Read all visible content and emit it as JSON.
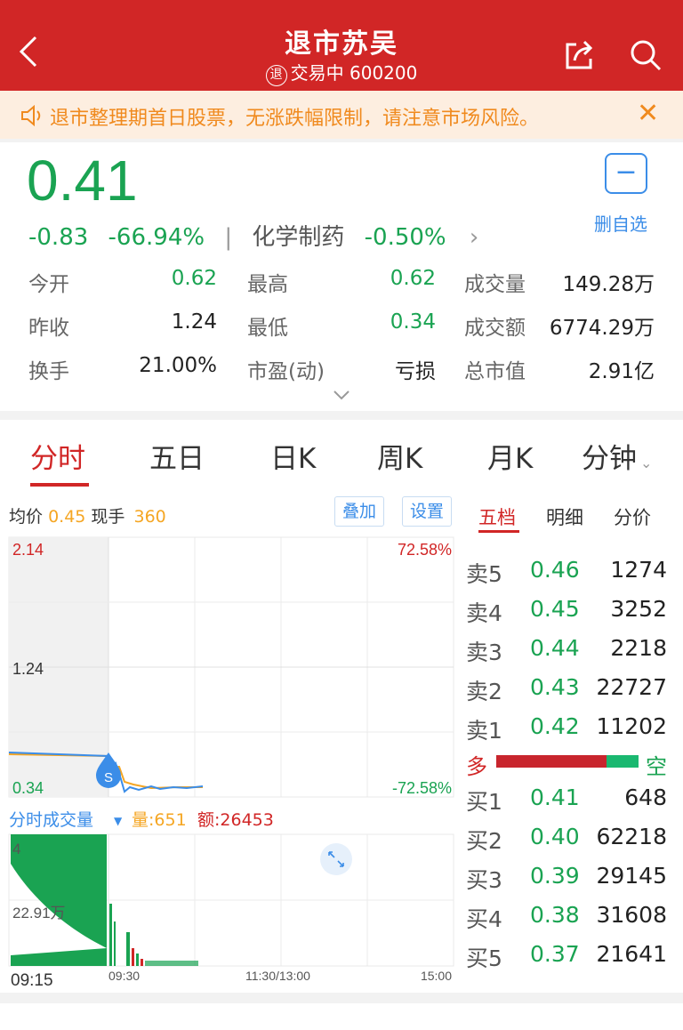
{
  "header": {
    "title": "退市苏吴",
    "badge": "退",
    "subtitle": "交易中 600200"
  },
  "notice": {
    "text": "退市整理期首日股票，无涨跌幅限制，请注意市场风险。",
    "close": "✕"
  },
  "quote": {
    "price": "0.41",
    "change": "-0.83",
    "change_pct": "-66.94%",
    "sector": "化学制药",
    "sector_pct": "-0.50%",
    "watchlist_label": "删自选",
    "stats": [
      {
        "label": "今开",
        "value": "0.62"
      },
      {
        "label": "最高",
        "value": "0.62"
      },
      {
        "label": "成交量",
        "value": "149.28万"
      },
      {
        "label": "昨收",
        "value": "1.24"
      },
      {
        "label": "最低",
        "value": "0.34"
      },
      {
        "label": "成交额",
        "value": "6774.29万"
      },
      {
        "label": "换手",
        "value": "21.00%"
      },
      {
        "label": "市盈(动)",
        "value": "亏损"
      },
      {
        "label": "总市值",
        "value": "2.91亿"
      }
    ]
  },
  "tabs": [
    "分时",
    "五日",
    "日K",
    "周K",
    "月K",
    "分钟"
  ],
  "chart": {
    "avg_label": "均价",
    "avg_value": "0.45",
    "cur_label": "现手",
    "cur_value": "360",
    "overlay_btn": "叠加",
    "settings_btn": "设置",
    "y_top": "2.14",
    "y_mid": "1.24",
    "y_bot": "0.34",
    "pct_top": "72.58%",
    "pct_bot": "-72.58%",
    "vol_title": "分时成交量",
    "vol_qty": "量:651",
    "vol_amt": "额:26453",
    "vol_top": "4",
    "vol_mid": "22.91万",
    "x_labels": [
      "09:15",
      "09:30",
      "11:30/13:00",
      "15:00"
    ],
    "marker": "S"
  },
  "orderbook": {
    "tabs": [
      "五档",
      "明细",
      "分价"
    ],
    "asks": [
      {
        "label": "卖5",
        "price": "0.46",
        "vol": "1274"
      },
      {
        "label": "卖4",
        "price": "0.45",
        "vol": "3252"
      },
      {
        "label": "卖3",
        "price": "0.44",
        "vol": "2218"
      },
      {
        "label": "卖2",
        "price": "0.43",
        "vol": "22727"
      },
      {
        "label": "卖1",
        "price": "0.42",
        "vol": "11202"
      }
    ],
    "bull": "多",
    "bear": "空",
    "bids": [
      {
        "label": "买1",
        "price": "0.41",
        "vol": "648"
      },
      {
        "label": "买2",
        "price": "0.40",
        "vol": "62218"
      },
      {
        "label": "买3",
        "price": "0.39",
        "vol": "29145"
      },
      {
        "label": "买4",
        "price": "0.38",
        "vol": "31608"
      },
      {
        "label": "买5",
        "price": "0.37",
        "vol": "21641"
      }
    ]
  },
  "colors": {
    "header": "#d12626",
    "up": "#d12626",
    "down": "#1aa352",
    "accent": "#3b8de8",
    "avg": "#f5a623"
  }
}
